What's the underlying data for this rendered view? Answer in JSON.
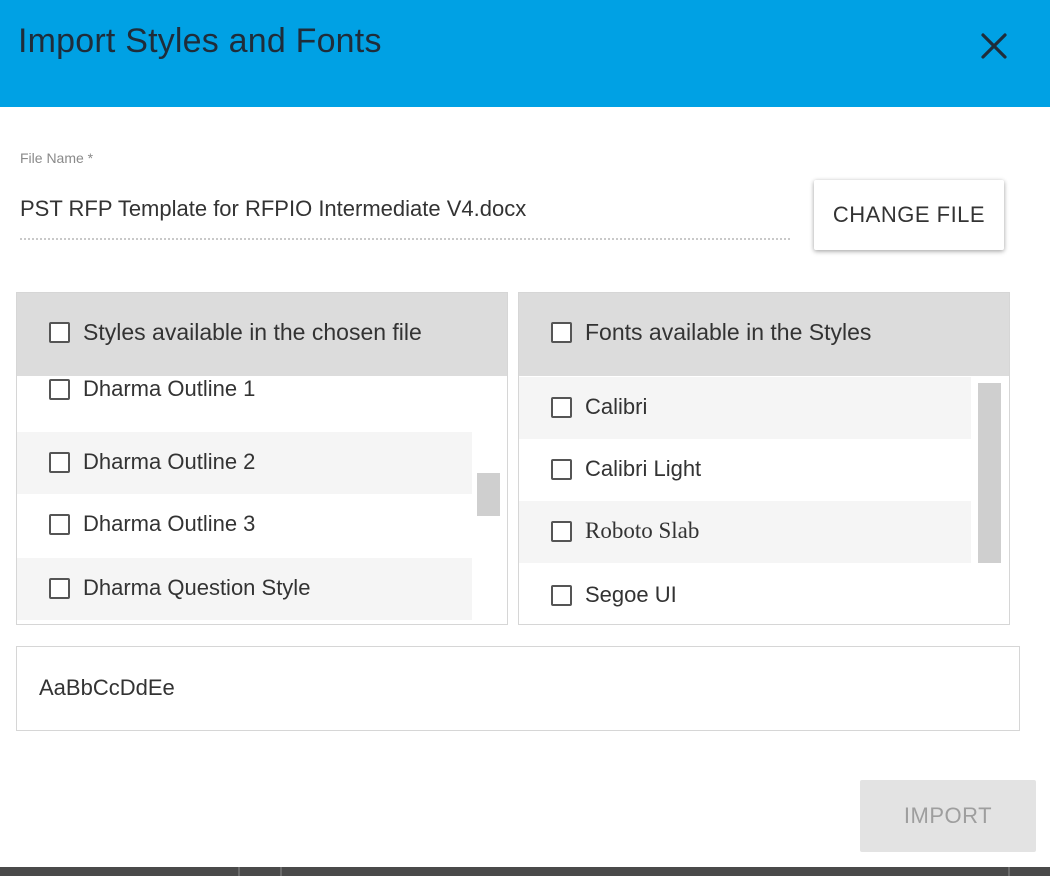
{
  "dialog": {
    "title": "Import Styles and Fonts",
    "header_color": "#00a1e4",
    "close_icon": "close-icon"
  },
  "file": {
    "label": "File Name *",
    "value": "PST RFP Template for RFPIO Intermediate V4.docx",
    "change_button": "CHANGE FILE"
  },
  "styles_panel": {
    "header": "Styles available in the chosen file",
    "items": [
      {
        "label": "Dharma Outline 1",
        "checked": false
      },
      {
        "label": "Dharma Outline 2",
        "checked": false
      },
      {
        "label": "Dharma Outline 3",
        "checked": false
      },
      {
        "label": "Dharma Question Style",
        "checked": false
      }
    ]
  },
  "fonts_panel": {
    "header": "Fonts available in the Styles",
    "items": [
      {
        "label": "Calibri",
        "checked": false
      },
      {
        "label": "Calibri Light",
        "checked": false
      },
      {
        "label": "Roboto Slab",
        "checked": false
      },
      {
        "label": "Segoe UI",
        "checked": false
      }
    ]
  },
  "preview": {
    "sample_text": "AaBbCcDdEe"
  },
  "footer": {
    "import_button": "IMPORT",
    "import_disabled": true
  }
}
